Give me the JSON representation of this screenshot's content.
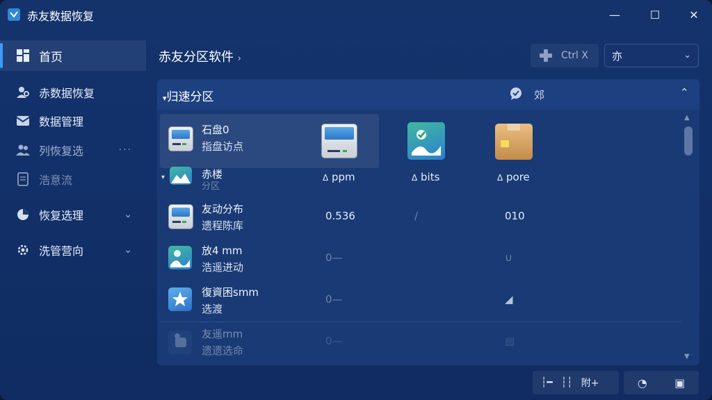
{
  "window": {
    "title": "赤友数据恢复",
    "minimize": "—",
    "maximize": "☐",
    "close": "✕"
  },
  "sidebar": {
    "items": [
      {
        "label": "首页",
        "icon": "grid-icon"
      },
      {
        "label": "赤数据恢复",
        "icon": "person-gear-icon"
      },
      {
        "label": "数据管理",
        "icon": "envelope-icon"
      },
      {
        "label": "列恢复选",
        "icon": "users-icon",
        "extra": "···"
      },
      {
        "label": "浩意流",
        "icon": "document-icon"
      },
      {
        "label": "恢复选理",
        "icon": "pie-chart-icon",
        "extra": "⌄"
      },
      {
        "label": "洗管营向",
        "icon": "gear-icon",
        "extra": "⌄"
      }
    ]
  },
  "header": {
    "title": "赤友分区软件",
    "title_arrow": "›",
    "action_label": "Ctrl X",
    "select_value": "亦",
    "select_chevron": "⌄"
  },
  "panel": {
    "arrow": "▾",
    "title": "归速分区",
    "right_label": "郊",
    "collapse_icon": "⌃",
    "rows": [
      {
        "name": "石盘0",
        "sub": "指盘访点"
      },
      {
        "name": "赤楼",
        "sub": "分区"
      },
      {
        "name": "友动分布",
        "sub": "遗程陈库",
        "c1": "0.536",
        "c2": "/",
        "c3": "010"
      },
      {
        "name": "放4 mm",
        "sub": "浩遥进动",
        "c1": "0—",
        "c3": "∪"
      },
      {
        "name": "復資困smm",
        "sub": "选渡",
        "c1": "0—",
        "c3": "◢"
      },
      {
        "name": "友遥mm",
        "sub": "遗遗选命",
        "c1": "0—",
        "c3": "▤"
      }
    ],
    "tiles": [
      {
        "label": "ppm",
        "prefix": "Δ"
      },
      {
        "label": "bits",
        "prefix": "Δ"
      },
      {
        "label": "pore",
        "prefix": "Δ"
      }
    ]
  },
  "footer": {
    "group1": [
      "┆━",
      "┆┆",
      "附+"
    ],
    "group2": [
      "◔",
      "▣"
    ]
  },
  "colors": {
    "accent": "#3b9bff",
    "background": "#12306a",
    "panel": "#193a74"
  }
}
